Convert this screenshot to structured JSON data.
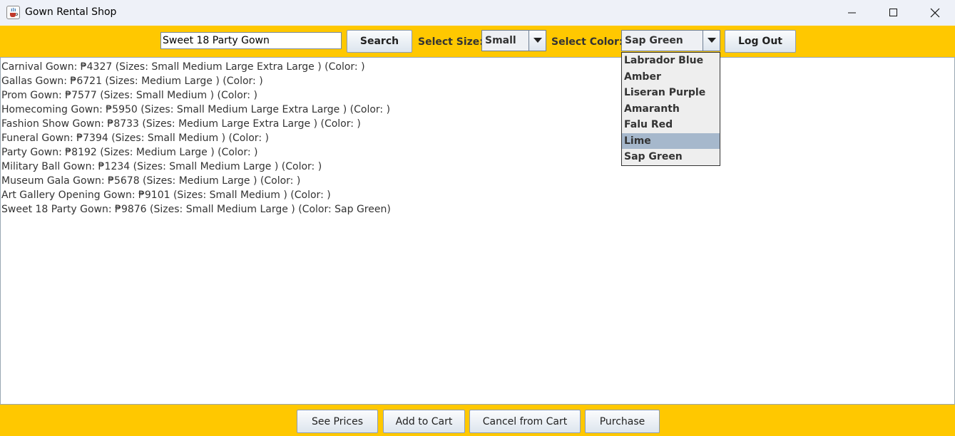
{
  "window": {
    "title": "Gown Rental Shop",
    "icon": "java-coffee-icon",
    "controls": [
      "minimize-icon",
      "maximize-icon",
      "close-icon"
    ]
  },
  "toolbar": {
    "search_value": "Sweet 18 Party Gown",
    "search_label": "Search",
    "size_label": "Select Size:",
    "size_selected": "Small",
    "color_label": "Select Color:",
    "color_selected": "Sap Green",
    "logout_label": "Log Out"
  },
  "color_dropdown": {
    "options": [
      "Labrador Blue",
      "Amber",
      "Liseran Purple",
      "Amaranth",
      "Falu Red",
      "Lime",
      "Sap Green"
    ],
    "highlighted": "Lime"
  },
  "gowns": [
    "Carnival Gown: ₱4327 (Sizes: Small Medium Large Extra Large ) (Color: )",
    "Gallas Gown: ₱6721 (Sizes: Medium Large ) (Color: )",
    "Prom Gown: ₱7577 (Sizes: Small Medium ) (Color: )",
    "Homecoming Gown: ₱5950 (Sizes: Small Medium Large Extra Large ) (Color: )",
    "Fashion Show Gown: ₱8733 (Sizes: Medium Large Extra Large ) (Color: )",
    "Funeral Gown: ₱7394 (Sizes: Small Medium ) (Color: )",
    "Party Gown: ₱8192 (Sizes: Medium Large ) (Color: )",
    "Military Ball Gown: ₱1234 (Sizes: Small Medium Large ) (Color: )",
    "Museum Gala Gown: ₱5678 (Sizes: Medium Large ) (Color: )",
    "Art Gallery Opening Gown: ₱9101 (Sizes: Small Medium ) (Color: )",
    "Sweet 18 Party Gown: ₱9876 (Sizes: Small Medium Large ) (Color: Sap Green)"
  ],
  "bottom": {
    "see_prices": "See Prices",
    "add_to_cart": "Add to Cart",
    "cancel_from_cart": "Cancel from Cart",
    "purchase": "Purchase"
  },
  "colors": {
    "accent_bar": "#ffc800",
    "title_bar": "#eef1f8",
    "highlight": "#a6b8cc"
  }
}
